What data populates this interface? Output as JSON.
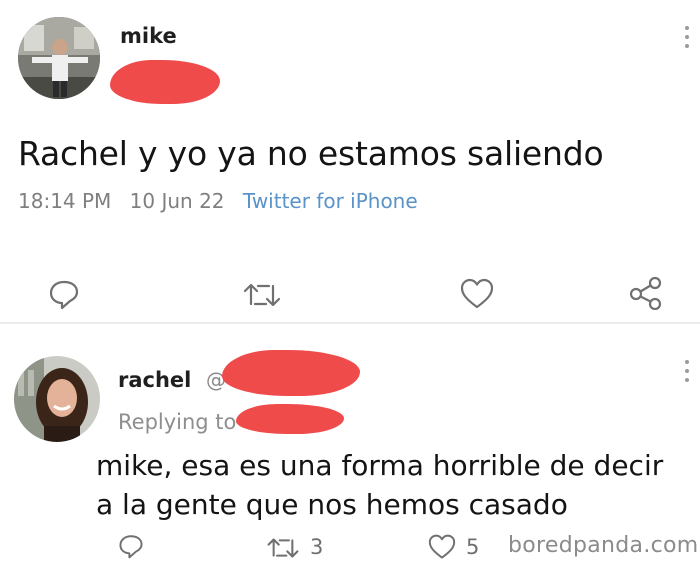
{
  "original_tweet": {
    "author_name": "mike",
    "text": "Rachel y yo ya no estamos saliendo",
    "time": "18:14 PM",
    "date": "10 Jun 22",
    "client": "Twitter for iPhone"
  },
  "reply_tweet": {
    "author_name": "rachel",
    "handle_prefix": "@",
    "replying_to_label": "Replying to",
    "text_line1": "mike, esa es una forma horrible de decir",
    "text_line2": "a la gente que nos hemos casado",
    "retweet_count": "3",
    "like_count": "5"
  },
  "watermark": "boredpanda.com",
  "colors": {
    "redaction": "#ef4b4b",
    "client_link": "#5a93c8",
    "icon_gray": "#707070"
  },
  "icons": [
    "comment-icon",
    "retweet-icon",
    "heart-icon",
    "share-icon",
    "more-options-icon"
  ]
}
